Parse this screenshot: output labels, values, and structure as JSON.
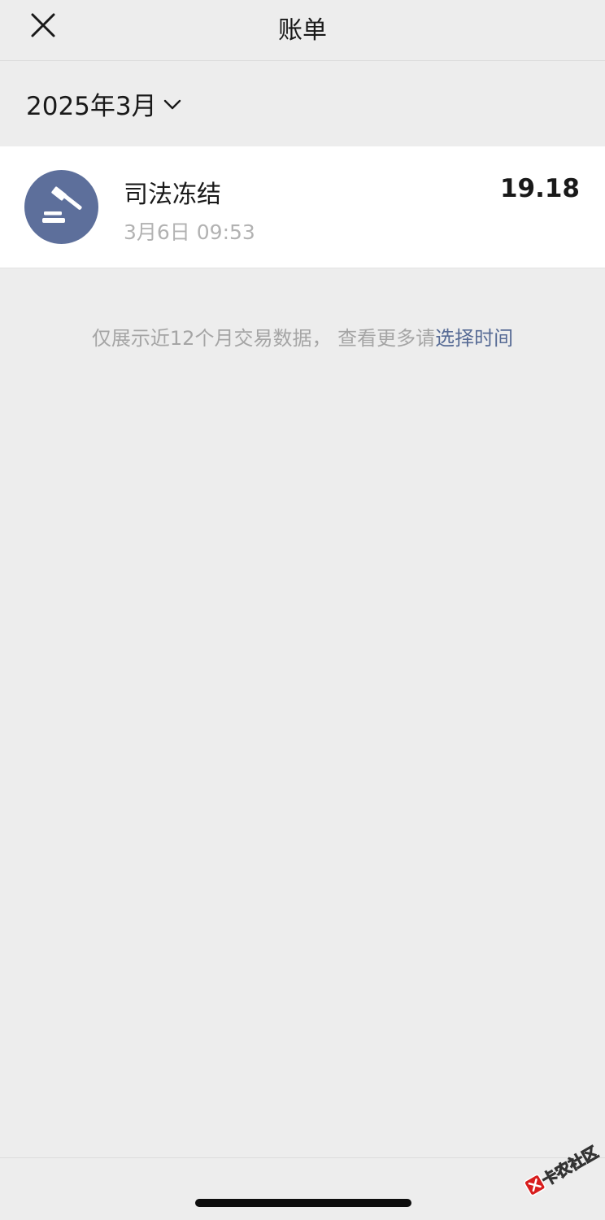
{
  "nav": {
    "title": "账单"
  },
  "month": {
    "label": "2025年3月"
  },
  "bills": [
    {
      "title": "司法冻结",
      "time": "3月6日 09:53",
      "amount": "19.18",
      "icon": "gavel-icon"
    }
  ],
  "note": {
    "text": "仅展示近12个月交易数据， 查看更多请",
    "link": "选择时间"
  },
  "watermark": {
    "text": "卡农社区"
  },
  "colors": {
    "accent": "#576b95",
    "avatar_bg": "#5d6f9b",
    "background": "#ededed"
  }
}
